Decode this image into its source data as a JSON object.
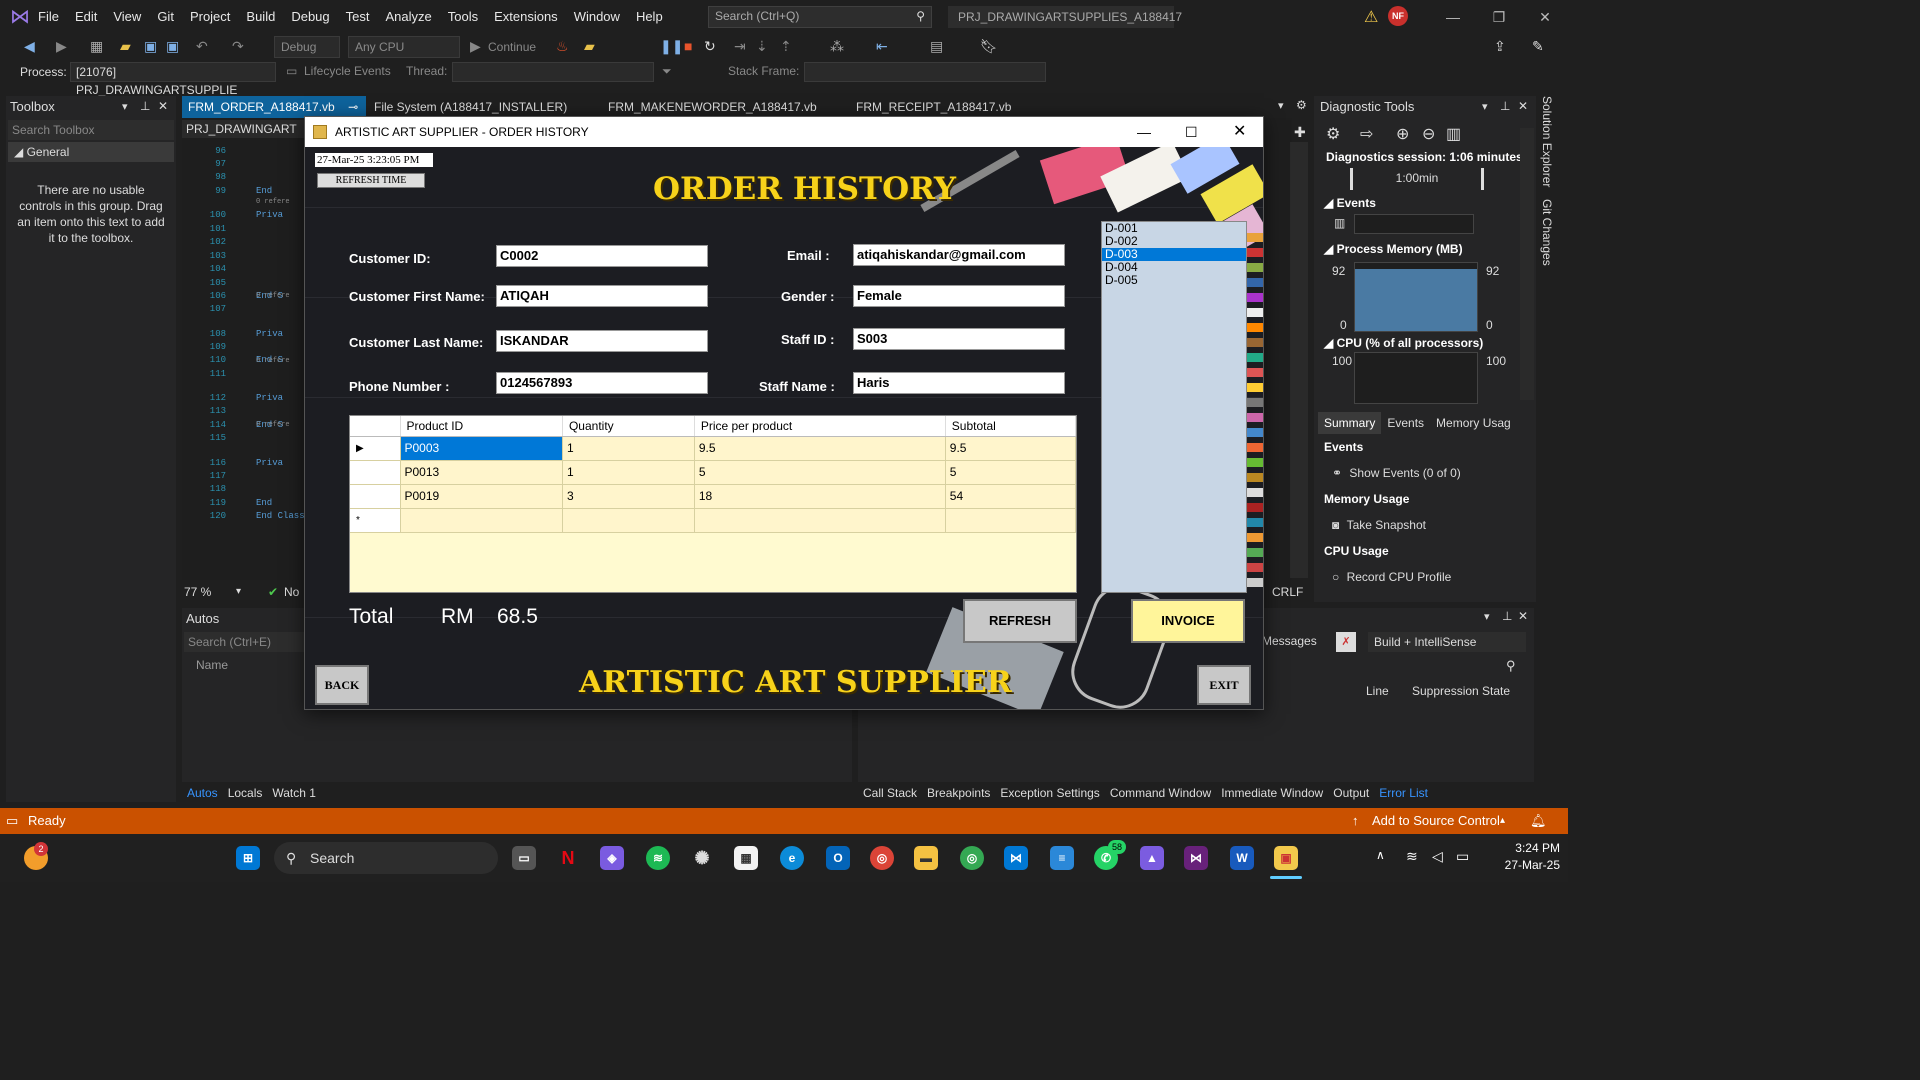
{
  "vs": {
    "menu": [
      "File",
      "Edit",
      "View",
      "Git",
      "Project",
      "Build",
      "Debug",
      "Test",
      "Analyze",
      "Tools",
      "Extensions",
      "Window",
      "Help"
    ],
    "search_placeholder": "Search (Ctrl+Q)",
    "solution_name": "PRJ_DRAWINGARTSUPPLIES_A188417",
    "avatar_initials": "NF",
    "toolbar": {
      "debug_config": "Debug",
      "platform": "Any CPU",
      "continue_label": "Continue"
    },
    "process_label": "Process:",
    "process_value": "[21076] PRJ_DRAWINGARTSUPPLIE",
    "lifecycle_label": "Lifecycle Events",
    "thread_label": "Thread:",
    "stack_frame_label": "Stack Frame:",
    "toolbox": {
      "title": "Toolbox",
      "search_placeholder": "Search Toolbox",
      "group": "General",
      "empty_message": "There are no usable controls in this group. Drag an item onto this text to add it to the toolbox."
    },
    "tabs": [
      "FRM_ORDER_A188417.vb",
      "File System (A188417_INSTALLER)",
      "FRM_MAKENEWORDER_A188417.vb",
      "FRM_RECEIPT_A188417.vb"
    ],
    "nav_dropdown": "PRJ_DRAWINGART",
    "line_numbers": [
      "96",
      "97",
      "98",
      "99",
      "100",
      "101",
      "102",
      "103",
      "104",
      "105",
      "106",
      "107",
      "108",
      "109",
      "110",
      "111",
      "112",
      "113",
      "114",
      "115",
      "116",
      "117",
      "118",
      "119",
      "120"
    ],
    "code_snippets": {
      "end": "End",
      "end_s": "End S",
      "priva": "Priva",
      "end_class": "End Class",
      "zero_refs": "0 refere"
    },
    "zoom": "77 %",
    "no_issues": "No",
    "line_ending": "CRLF",
    "autos": {
      "title": "Autos",
      "search_placeholder": "Search (Ctrl+E)",
      "column": "Name"
    },
    "autos_tabs": [
      "Autos",
      "Locals",
      "Watch 1"
    ],
    "error_list": {
      "messages": "Messages",
      "build_filter": "Build + IntelliSense",
      "col_line": "Line",
      "col_suppression": "Suppression State"
    },
    "bottom_tabs": [
      "Call Stack",
      "Breakpoints",
      "Exception Settings",
      "Command Window",
      "Immediate Window",
      "Output",
      "Error List"
    ],
    "diagnostics": {
      "title": "Diagnostic Tools",
      "session": "Diagnostics session: 1:06 minutes",
      "timeline_label": "1:00min",
      "events_title": "Events",
      "memory_title": "Process Memory (MB)",
      "memory_max": "92",
      "memory_min": "0",
      "cpu_title": "CPU (% of all processors)",
      "cpu_max": "100",
      "tabs": [
        "Summary",
        "Events",
        "Memory Usag"
      ],
      "events_section": "Events",
      "show_events": "Show Events (0 of 0)",
      "memory_section": "Memory Usage",
      "take_snapshot": "Take Snapshot",
      "cpu_section": "CPU Usage",
      "record_cpu": "Record CPU Profile"
    },
    "side_tabs": [
      "Solution Explorer",
      "Git Changes"
    ],
    "status": {
      "ready": "Ready",
      "source_control": "Add to Source Control"
    }
  },
  "taskbar": {
    "search": "Search",
    "notif_badge": "2",
    "whatsapp_badge": "58",
    "time": "3:24 PM",
    "date": "27-Mar-25"
  },
  "form": {
    "window_title": "ARTISTIC ART SUPPLIER - ORDER HISTORY",
    "timestamp": "27-Mar-25 3:23:05 PM",
    "refresh_time_label": "REFRESH TIME",
    "heading": "ORDER HISTORY",
    "footer_brand": "ARTISTIC ART SUPPLIER",
    "fields": {
      "customer_id": {
        "label": "Customer ID:",
        "value": "C0002"
      },
      "first_name": {
        "label": "Customer First Name:",
        "value": "ATIQAH"
      },
      "last_name": {
        "label": "Customer Last Name:",
        "value": "ISKANDAR"
      },
      "phone": {
        "label": "Phone Number :",
        "value": "0124567893"
      },
      "email": {
        "label": "Email :",
        "value": "atiqahiskandar@gmail.com"
      },
      "gender": {
        "label": "Gender :",
        "value": "Female"
      },
      "staff_id": {
        "label": "Staff ID :",
        "value": "S003"
      },
      "staff_name": {
        "label": "Staff Name :",
        "value": "Haris"
      }
    },
    "grid": {
      "columns": [
        "Product ID",
        "Quantity",
        "Price per product",
        "Subtotal"
      ],
      "rows": [
        [
          "P0003",
          "1",
          "9.5",
          "9.5"
        ],
        [
          "P0013",
          "1",
          "5",
          "5"
        ],
        [
          "P0019",
          "3",
          "18",
          "54"
        ]
      ],
      "selected_row": 0,
      "new_row_marker": "*"
    },
    "orders": [
      "D-001",
      "D-002",
      "D-003",
      "D-004",
      "D-005"
    ],
    "selected_order": "D-003",
    "total_label": "Total",
    "currency": "RM",
    "total_value": "68.5",
    "buttons": {
      "refresh": "REFRESH",
      "invoice": "INVOICE",
      "back": "BACK",
      "exit": "EXIT"
    }
  }
}
